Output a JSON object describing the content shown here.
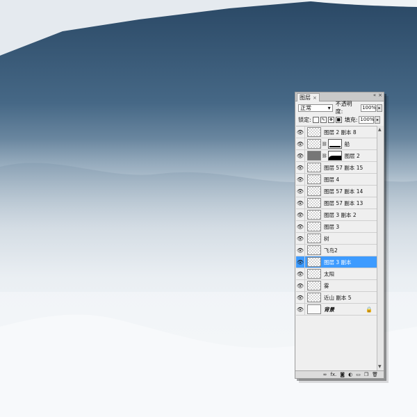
{
  "panel": {
    "tab_label": "图层",
    "tab_close": "×",
    "blend_mode": "正常",
    "opacity_label": "不透明度:",
    "opacity_value": "100%",
    "lock_label": "锁定:",
    "fill_label": "填充:",
    "fill_value": "100%"
  },
  "layers": [
    {
      "name": "图层 2 副本 8",
      "thumb": "transparent"
    },
    {
      "name": "船",
      "thumb": "transparent",
      "mask": "white"
    },
    {
      "name": "图层 2",
      "thumb": "dark",
      "mask": "wave"
    },
    {
      "name": "图层 57 副本 15",
      "thumb": "transparent"
    },
    {
      "name": "图层 4",
      "thumb": "transparent"
    },
    {
      "name": "图层 57 副本 14",
      "thumb": "transparent"
    },
    {
      "name": "图层 57 副本 13",
      "thumb": "transparent"
    },
    {
      "name": "图层 3 副本 2",
      "thumb": "transparent"
    },
    {
      "name": "图层 3",
      "thumb": "transparent"
    },
    {
      "name": "树",
      "thumb": "transparent"
    },
    {
      "name": "飞鸟2",
      "thumb": "transparent"
    },
    {
      "name": "图层 3 副本",
      "thumb": "transparent",
      "selected": true
    },
    {
      "name": "太阳",
      "thumb": "transparent"
    },
    {
      "name": "雾",
      "thumb": "transparent"
    },
    {
      "name": "近山 副本 5",
      "thumb": "transparent"
    },
    {
      "name": "背景",
      "thumb": "plain",
      "locked": true,
      "italic": true
    }
  ],
  "bottom_icons": [
    "link-icon",
    "fx-icon",
    "mask-icon",
    "adjustment-icon",
    "folder-icon",
    "new-layer-icon",
    "trash-icon"
  ],
  "bottom_fx": "fx.",
  "colors": {
    "selected": "#3d9bff",
    "sky": "#2f4d68",
    "fog": "#f3f6f8"
  }
}
